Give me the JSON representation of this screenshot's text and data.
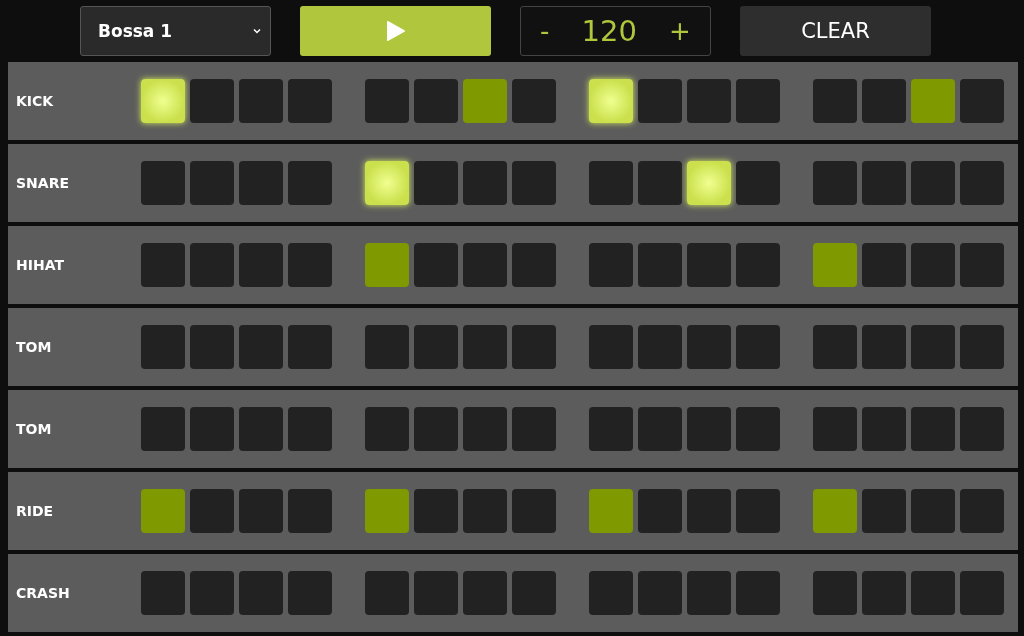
{
  "pattern": {
    "value": "Bossa 1"
  },
  "tempo": {
    "decrement": "-",
    "value": "120",
    "increment": "+"
  },
  "clear_button": "CLEAR",
  "tracks": [
    {
      "name": "KICK",
      "steps": [
        {
          "on": true,
          "accent": true
        },
        {
          "on": false,
          "accent": false
        },
        {
          "on": false,
          "accent": false
        },
        {
          "on": false,
          "accent": false
        },
        {
          "on": false,
          "accent": false
        },
        {
          "on": false,
          "accent": false
        },
        {
          "on": true,
          "accent": false
        },
        {
          "on": false,
          "accent": false
        },
        {
          "on": true,
          "accent": true
        },
        {
          "on": false,
          "accent": false
        },
        {
          "on": false,
          "accent": false
        },
        {
          "on": false,
          "accent": false
        },
        {
          "on": false,
          "accent": false
        },
        {
          "on": false,
          "accent": false
        },
        {
          "on": true,
          "accent": false
        },
        {
          "on": false,
          "accent": false
        }
      ]
    },
    {
      "name": "SNARE",
      "steps": [
        {
          "on": false,
          "accent": false
        },
        {
          "on": false,
          "accent": false
        },
        {
          "on": false,
          "accent": false
        },
        {
          "on": false,
          "accent": false
        },
        {
          "on": true,
          "accent": true
        },
        {
          "on": false,
          "accent": false
        },
        {
          "on": false,
          "accent": false
        },
        {
          "on": false,
          "accent": false
        },
        {
          "on": false,
          "accent": false
        },
        {
          "on": false,
          "accent": false
        },
        {
          "on": true,
          "accent": true
        },
        {
          "on": false,
          "accent": false
        },
        {
          "on": false,
          "accent": false
        },
        {
          "on": false,
          "accent": false
        },
        {
          "on": false,
          "accent": false
        },
        {
          "on": false,
          "accent": false
        }
      ]
    },
    {
      "name": "HIHAT",
      "steps": [
        {
          "on": false,
          "accent": false
        },
        {
          "on": false,
          "accent": false
        },
        {
          "on": false,
          "accent": false
        },
        {
          "on": false,
          "accent": false
        },
        {
          "on": true,
          "accent": false
        },
        {
          "on": false,
          "accent": false
        },
        {
          "on": false,
          "accent": false
        },
        {
          "on": false,
          "accent": false
        },
        {
          "on": false,
          "accent": false
        },
        {
          "on": false,
          "accent": false
        },
        {
          "on": false,
          "accent": false
        },
        {
          "on": false,
          "accent": false
        },
        {
          "on": true,
          "accent": false
        },
        {
          "on": false,
          "accent": false
        },
        {
          "on": false,
          "accent": false
        },
        {
          "on": false,
          "accent": false
        }
      ]
    },
    {
      "name": "TOM",
      "steps": [
        {
          "on": false,
          "accent": false
        },
        {
          "on": false,
          "accent": false
        },
        {
          "on": false,
          "accent": false
        },
        {
          "on": false,
          "accent": false
        },
        {
          "on": false,
          "accent": false
        },
        {
          "on": false,
          "accent": false
        },
        {
          "on": false,
          "accent": false
        },
        {
          "on": false,
          "accent": false
        },
        {
          "on": false,
          "accent": false
        },
        {
          "on": false,
          "accent": false
        },
        {
          "on": false,
          "accent": false
        },
        {
          "on": false,
          "accent": false
        },
        {
          "on": false,
          "accent": false
        },
        {
          "on": false,
          "accent": false
        },
        {
          "on": false,
          "accent": false
        },
        {
          "on": false,
          "accent": false
        }
      ]
    },
    {
      "name": "TOM",
      "steps": [
        {
          "on": false,
          "accent": false
        },
        {
          "on": false,
          "accent": false
        },
        {
          "on": false,
          "accent": false
        },
        {
          "on": false,
          "accent": false
        },
        {
          "on": false,
          "accent": false
        },
        {
          "on": false,
          "accent": false
        },
        {
          "on": false,
          "accent": false
        },
        {
          "on": false,
          "accent": false
        },
        {
          "on": false,
          "accent": false
        },
        {
          "on": false,
          "accent": false
        },
        {
          "on": false,
          "accent": false
        },
        {
          "on": false,
          "accent": false
        },
        {
          "on": false,
          "accent": false
        },
        {
          "on": false,
          "accent": false
        },
        {
          "on": false,
          "accent": false
        },
        {
          "on": false,
          "accent": false
        }
      ]
    },
    {
      "name": "RIDE",
      "steps": [
        {
          "on": true,
          "accent": false
        },
        {
          "on": false,
          "accent": false
        },
        {
          "on": false,
          "accent": false
        },
        {
          "on": false,
          "accent": false
        },
        {
          "on": true,
          "accent": false
        },
        {
          "on": false,
          "accent": false
        },
        {
          "on": false,
          "accent": false
        },
        {
          "on": false,
          "accent": false
        },
        {
          "on": true,
          "accent": false
        },
        {
          "on": false,
          "accent": false
        },
        {
          "on": false,
          "accent": false
        },
        {
          "on": false,
          "accent": false
        },
        {
          "on": true,
          "accent": false
        },
        {
          "on": false,
          "accent": false
        },
        {
          "on": false,
          "accent": false
        },
        {
          "on": false,
          "accent": false
        }
      ]
    },
    {
      "name": "CRASH",
      "steps": [
        {
          "on": false,
          "accent": false
        },
        {
          "on": false,
          "accent": false
        },
        {
          "on": false,
          "accent": false
        },
        {
          "on": false,
          "accent": false
        },
        {
          "on": false,
          "accent": false
        },
        {
          "on": false,
          "accent": false
        },
        {
          "on": false,
          "accent": false
        },
        {
          "on": false,
          "accent": false
        },
        {
          "on": false,
          "accent": false
        },
        {
          "on": false,
          "accent": false
        },
        {
          "on": false,
          "accent": false
        },
        {
          "on": false,
          "accent": false
        },
        {
          "on": false,
          "accent": false
        },
        {
          "on": false,
          "accent": false
        },
        {
          "on": false,
          "accent": false
        },
        {
          "on": false,
          "accent": false
        }
      ]
    }
  ]
}
